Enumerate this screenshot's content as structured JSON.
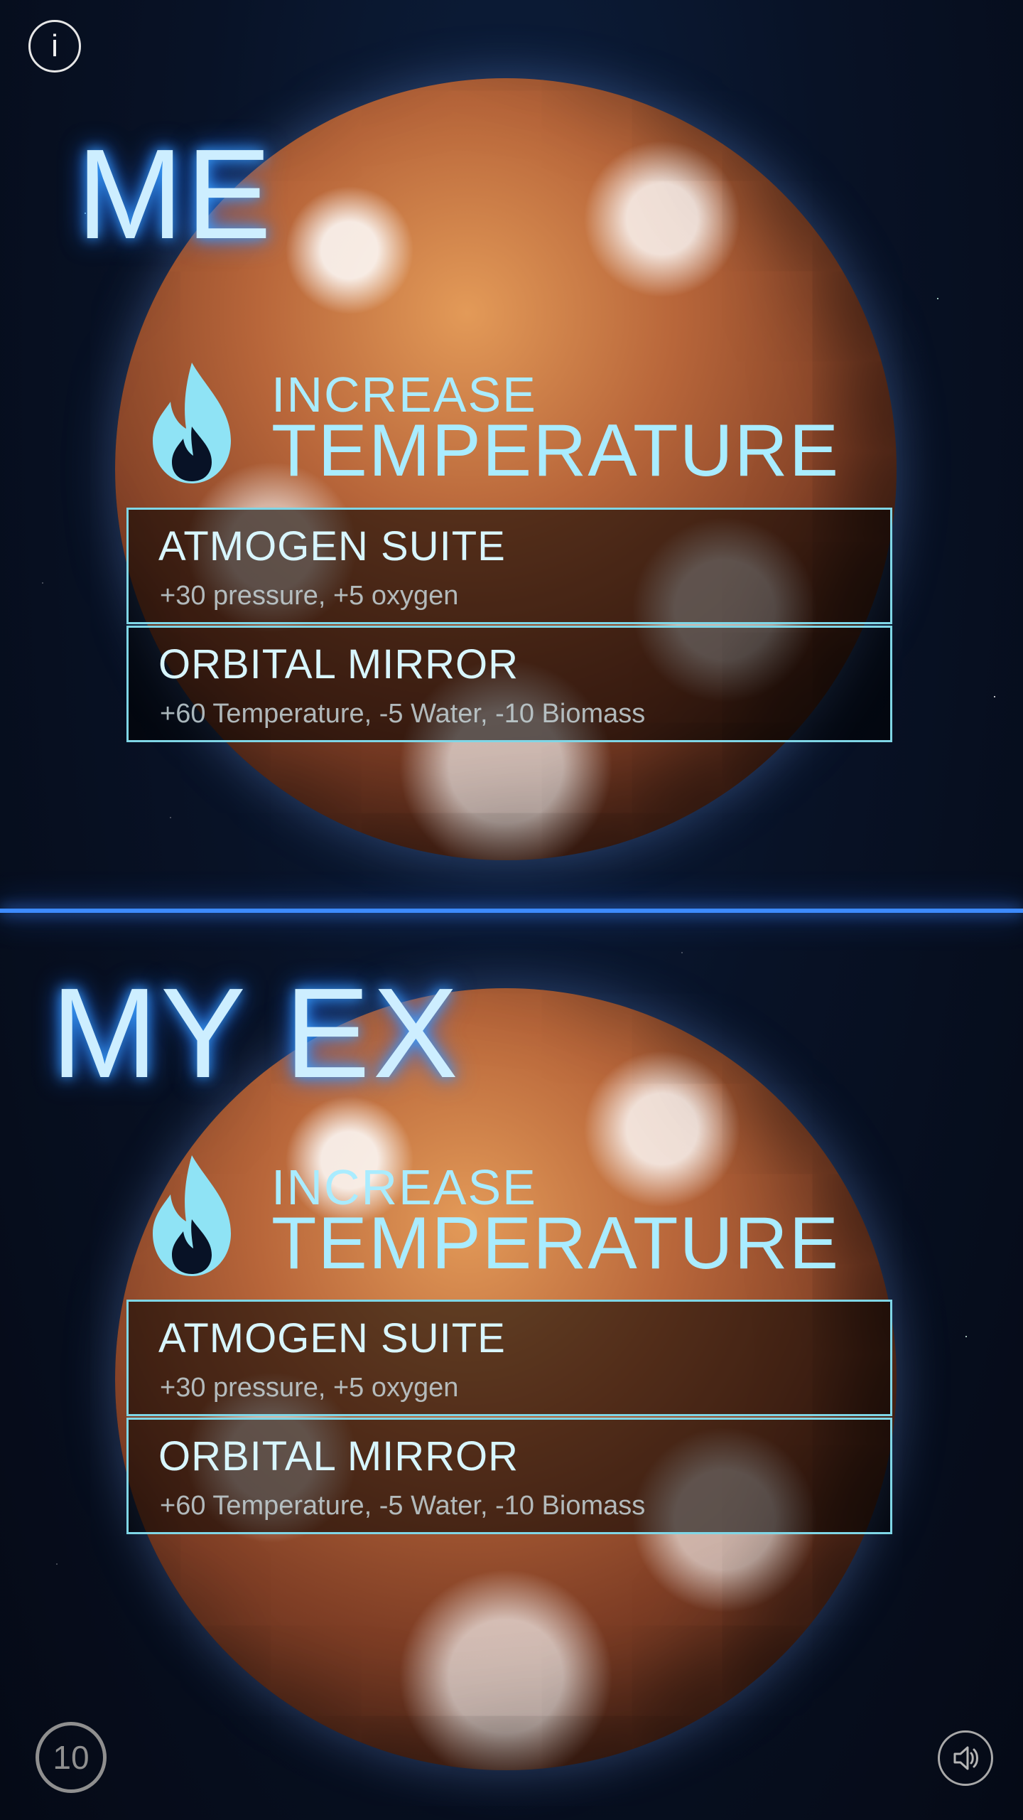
{
  "panels": [
    {
      "label": "ME",
      "action": {
        "small": "INCREASE",
        "large": "TEMPERATURE",
        "icon": "flame-icon"
      },
      "options": [
        {
          "name": "ATMOGEN SUITE",
          "desc": "+30 pressure, +5 oxygen"
        },
        {
          "name": "ORBITAL MIRROR",
          "desc": "+60 Temperature, -5 Water, -10 Biomass"
        }
      ]
    },
    {
      "label": "MY EX",
      "action": {
        "small": "INCREASE",
        "large": "TEMPERATURE",
        "icon": "flame-icon"
      },
      "options": [
        {
          "name": "ATMOGEN SUITE",
          "desc": "+30 pressure, +5 oxygen"
        },
        {
          "name": "ORBITAL MIRROR",
          "desc": "+60 Temperature, -5 Water, -10 Biomass"
        }
      ]
    }
  ],
  "controls": {
    "info": "i",
    "counter": "10",
    "sound_icon": "speaker-icon"
  },
  "colors": {
    "glow_blue": "#3d8bff",
    "accent_cyan": "#a9ecff",
    "option_border": "#7fd6e6"
  }
}
